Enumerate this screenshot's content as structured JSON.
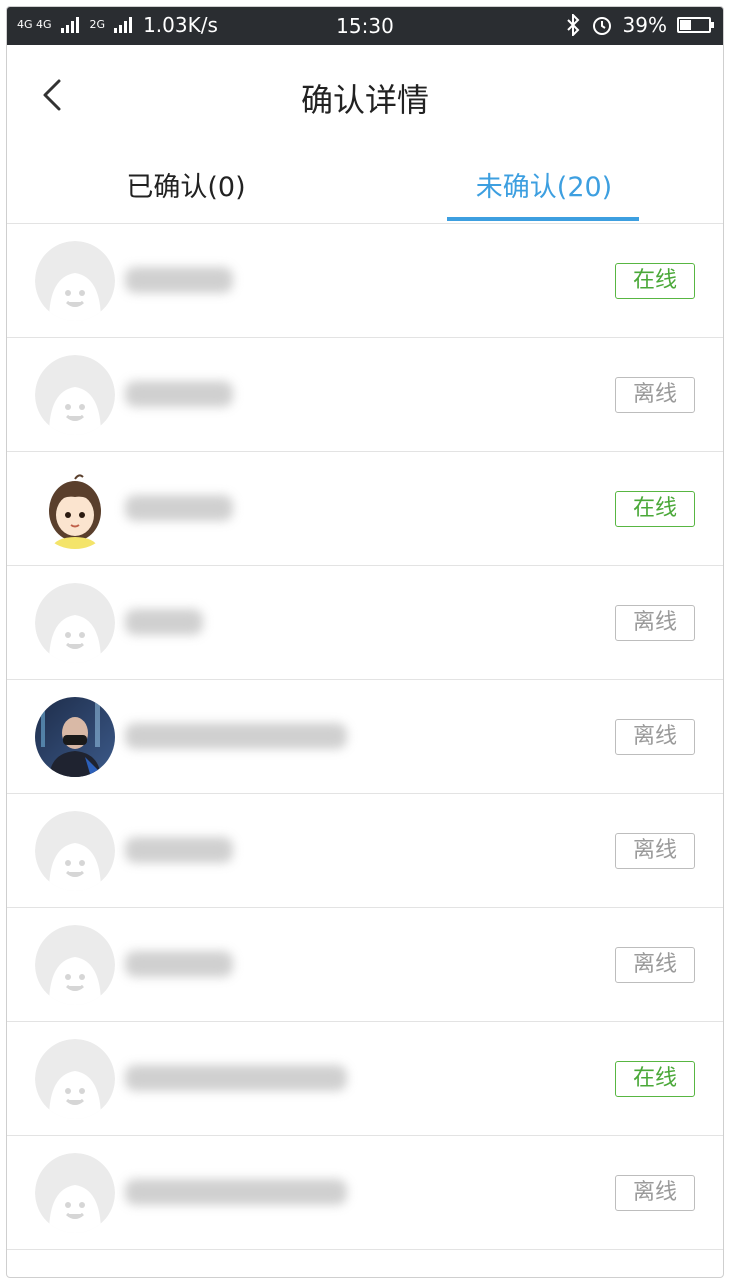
{
  "status_bar": {
    "network": "4G 4G",
    "network2": "2G",
    "speed": "1.03K/s",
    "time": "15:30",
    "battery": "39%",
    "battery_level": 0.39
  },
  "header": {
    "title": "确认详情"
  },
  "tabs": [
    {
      "label": "已确认(0)",
      "active": false
    },
    {
      "label": "未确认(20)",
      "active": true
    }
  ],
  "colors": {
    "accent": "#3d9fe0",
    "online": "#4aa838",
    "offline": "#9a9a9a",
    "status_bar": "#2a2d31"
  },
  "list": {
    "items": [
      {
        "avatar": "default-avatar-icon",
        "status": "在线",
        "online": true
      },
      {
        "avatar": "default-avatar-icon",
        "status": "离线",
        "online": false
      },
      {
        "avatar": "girl-avatar",
        "status": "在线",
        "online": true
      },
      {
        "avatar": "default-avatar-icon",
        "status": "离线",
        "online": false
      },
      {
        "avatar": "photo-avatar",
        "status": "离线",
        "online": false
      },
      {
        "avatar": "default-avatar-icon",
        "status": "离线",
        "online": false
      },
      {
        "avatar": "default-avatar-icon",
        "status": "离线",
        "online": false
      },
      {
        "avatar": "default-avatar-icon",
        "status": "在线",
        "online": true
      },
      {
        "avatar": "default-avatar-icon",
        "status": "离线",
        "online": false
      }
    ]
  }
}
